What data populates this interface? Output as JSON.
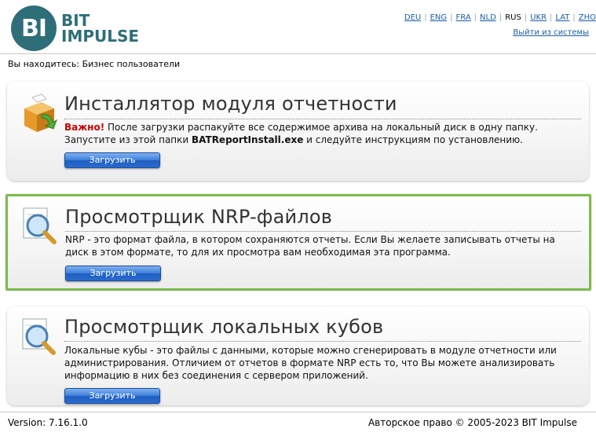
{
  "logo": {
    "mark": "BI",
    "line1": "BIT",
    "line2": "IMPULSE"
  },
  "languages": [
    {
      "code": "DEU",
      "current": false
    },
    {
      "code": "ENG",
      "current": false
    },
    {
      "code": "FRA",
      "current": false
    },
    {
      "code": "NLD",
      "current": false
    },
    {
      "code": "RUS",
      "current": true
    },
    {
      "code": "UKR",
      "current": false
    },
    {
      "code": "LAT",
      "current": false
    },
    {
      "code": "ZHO",
      "current": false
    }
  ],
  "logout": "Выйти из системы",
  "breadcrumb": "Вы находитесь: Бизнес пользователи",
  "cards": [
    {
      "title": "Инсталлятор модуля отчетности",
      "warn": "Важно!",
      "text1": " После загрузки распакуйте все содержимое архива на локальный диск в одну папку.",
      "text2a": "Запустите из этой папки ",
      "text2b": "BATReportInstall.exe",
      "text2c": " и следуйте инструкциям по установлению.",
      "button": "Загрузить",
      "icon": "installer-box-icon"
    },
    {
      "title": "Просмотрщик NRP-файлов",
      "text": "NRP - это формат файла, в котором сохраняются отчеты. Если Вы желаете записывать отчеты на диск в этом формате, то для их просмотра вам необходимая эта программа.",
      "button": "Загрузить",
      "icon": "magnifier-document-icon"
    },
    {
      "title": "Просмотрщик локальных кубов",
      "text": "Локальные кубы - это файлы с данными, которые можно сгенерировать в модуле отчетности или администрирования. Отличием от отчетов в формате NRP есть то, что Вы можете анализировать информацию в них без соединения с сервером приложений.",
      "button": "Загрузить",
      "icon": "magnifier-document-icon"
    }
  ],
  "footer": {
    "version": "Version: 7.16.1.0",
    "copyright": "Авторское право © 2005-2023 BIT Impulse"
  },
  "colors": {
    "brand": "#2e6e78",
    "link": "#1a5ea8",
    "warn": "#cc0000",
    "highlight": "#7dbb4e",
    "button": "#2a6ad0"
  }
}
